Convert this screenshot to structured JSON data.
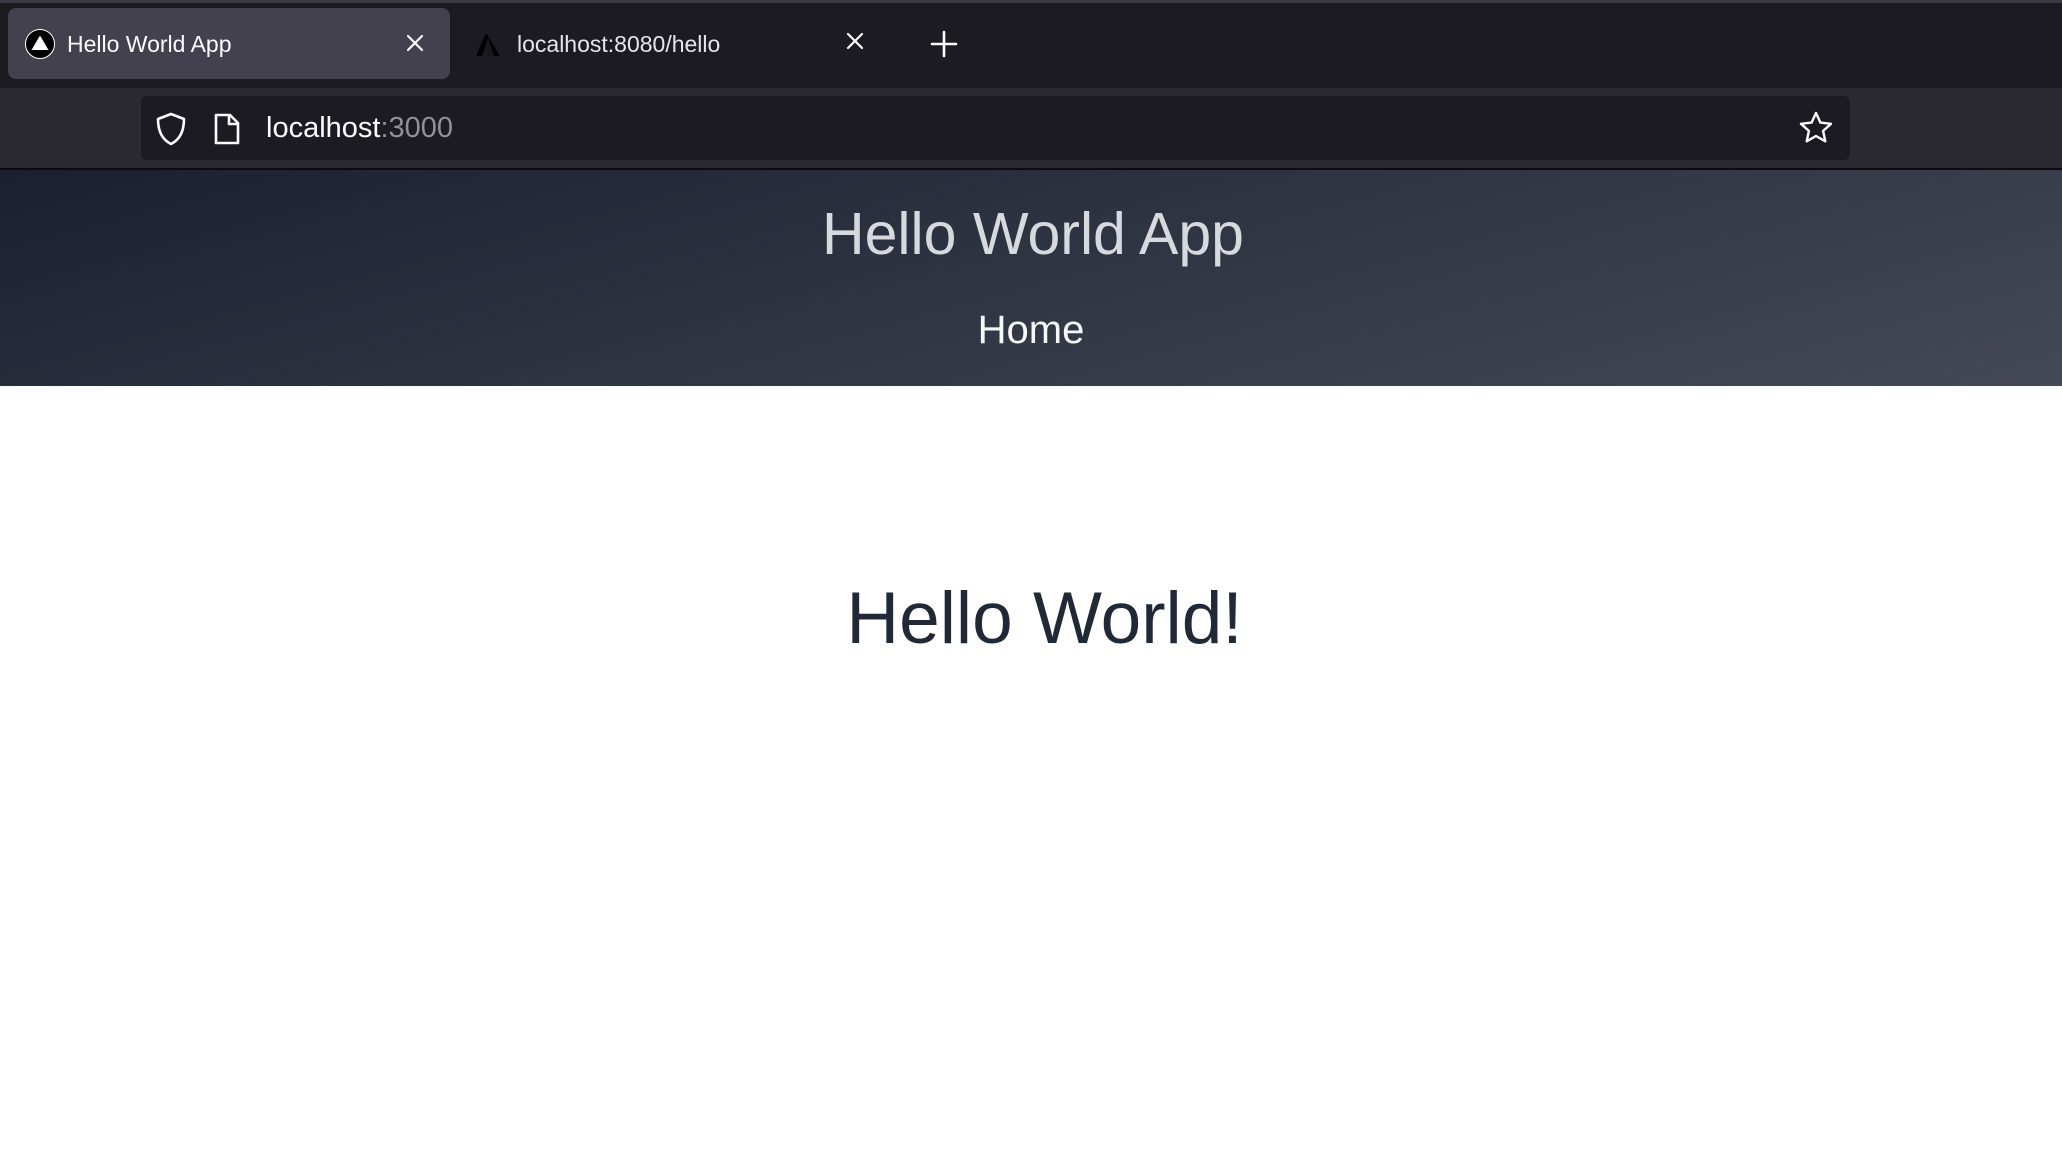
{
  "browser": {
    "tabs": [
      {
        "title": "Hello World App",
        "active": true
      },
      {
        "title": "localhost:8080/hello",
        "active": false
      }
    ],
    "url": {
      "host": "localhost",
      "port": ":3000"
    }
  },
  "page": {
    "app_title": "Hello World App",
    "nav": {
      "home_label": "Home"
    },
    "heading": "Hello World!"
  },
  "colors": {
    "chrome_bg": "#1c1b22",
    "active_tab": "#42414d",
    "toolbar": "#2b2a33",
    "header_gradient_start": "#1a2030",
    "header_gradient_end": "#444955",
    "heading_text": "#212836"
  },
  "icons": {
    "favicon": "triangle-logo-icon",
    "close": "close-icon",
    "new_tab": "plus-icon",
    "tracking": "shield-icon",
    "page": "page-icon",
    "bookmark": "star-icon"
  }
}
